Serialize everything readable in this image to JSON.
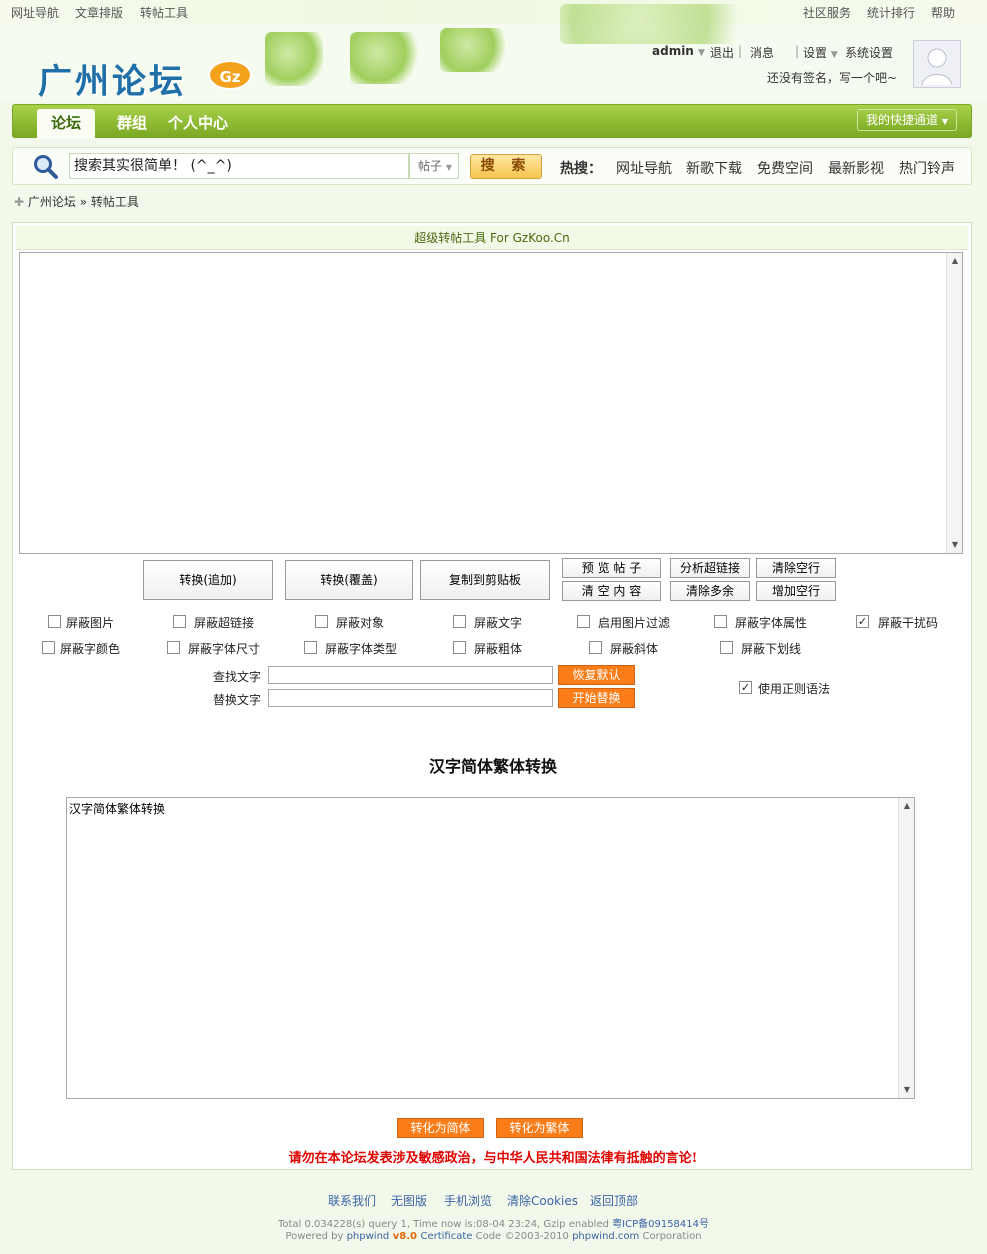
{
  "topbar": {
    "left_links": [
      "网址导航",
      "文章排版",
      "转帖工具"
    ],
    "right_links": [
      "社区服务",
      "统计排行",
      "帮助"
    ]
  },
  "header": {
    "logo_text": "广州论坛",
    "logo_badge": "Gz",
    "username": "admin",
    "user_links": [
      "退出",
      "消息",
      "设置",
      "系统设置"
    ],
    "separator": "|",
    "signature": "还没有签名，写一个吧~"
  },
  "nav": {
    "tabs": [
      "论坛",
      "群组",
      "个人中心"
    ],
    "quick_btn": "我的快捷通道"
  },
  "search": {
    "input_value": "搜索其实很简单！ (^_^)",
    "select_value": "帖子",
    "button_label": "搜 索",
    "hot_label": "热搜：",
    "hot_links": [
      "网址导航",
      "新歌下载",
      "免费空间",
      "最新影视",
      "热门铃声"
    ]
  },
  "breadcrumb": {
    "items": [
      "广州论坛",
      "» 转帖工具"
    ]
  },
  "tool": {
    "title": "超级转帖工具  For GzKoo.Cn",
    "main_text": "",
    "big_buttons": [
      "转换(追加)",
      "转换(覆盖)",
      "复制到剪贴板"
    ],
    "small_buttons": [
      "预 览 帖 子",
      "分析超链接",
      "清除空行",
      "清 空 内 容",
      "清除多余",
      "增加空行"
    ],
    "options_row1": [
      {
        "label": "屏蔽图片",
        "checked": false
      },
      {
        "label": "屏蔽超链接",
        "checked": false
      },
      {
        "label": "屏蔽对象",
        "checked": false
      },
      {
        "label": "屏蔽文字",
        "checked": false
      },
      {
        "label": "启用图片过滤",
        "checked": false
      },
      {
        "label": "屏蔽字体属性",
        "checked": false
      },
      {
        "label": "屏蔽干扰码",
        "checked": true
      }
    ],
    "options_row2": [
      {
        "label": "屏蔽字颜色",
        "checked": false
      },
      {
        "label": "屏蔽字体尺寸",
        "checked": false
      },
      {
        "label": "屏蔽字体类型",
        "checked": false
      },
      {
        "label": "屏蔽粗体",
        "checked": false
      },
      {
        "label": "屏蔽斜体",
        "checked": false
      },
      {
        "label": "屏蔽下划线",
        "checked": false
      }
    ],
    "find_label": "查找文字",
    "replace_label": "替换文字",
    "find_value": "",
    "replace_value": "",
    "restore_btn": "恢复默认",
    "start_replace_btn": "开始替换",
    "regex_label": "使用正则语法",
    "regex_checked": true
  },
  "converter": {
    "title": "汉字简体繁体转换",
    "text": "汉字简体繁体转换",
    "to_simplified": "转化为简体",
    "to_traditional": "转化为繁体",
    "warning": "请勿在本论坛发表涉及敏感政治，与中华人民共和国法律有抵触的言论!"
  },
  "footer": {
    "links": [
      "联系我们",
      "无图版",
      "手机浏览",
      "清除Cookies",
      "返回顶部"
    ],
    "stats_text": "Total 0.034228(s) query 1, Time now is:08-04 23:24, Gzip enabled ",
    "icp": "粤ICP备09158414号",
    "powered_prefix": "Powered by ",
    "powered_brand": "phpwind",
    "powered_version": " v8.0 ",
    "powered_cert": "Certificate",
    "powered_code": " Code ©2003-2010 ",
    "powered_site": "phpwind.com",
    "powered_suffix": " Corporation"
  }
}
